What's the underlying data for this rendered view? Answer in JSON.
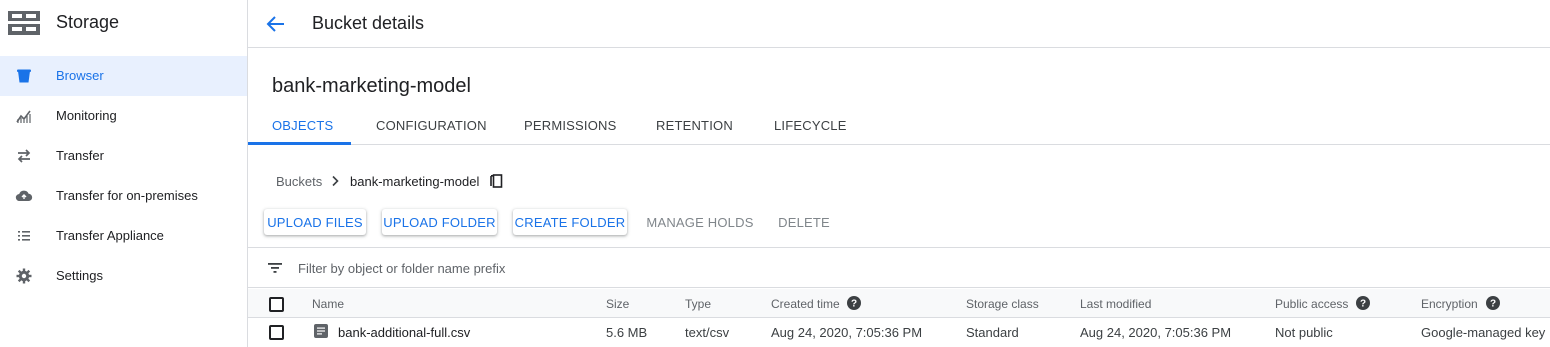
{
  "sidebar": {
    "title": "Storage",
    "items": [
      {
        "label": "Browser",
        "icon": "bucket-icon"
      },
      {
        "label": "Monitoring",
        "icon": "chart-icon"
      },
      {
        "label": "Transfer",
        "icon": "transfer-arrows-icon"
      },
      {
        "label": "Transfer for on-premises",
        "icon": "cloud-upload-icon"
      },
      {
        "label": "Transfer Appliance",
        "icon": "list-icon"
      },
      {
        "label": "Settings",
        "icon": "gear-icon"
      }
    ],
    "active_index": 0
  },
  "header": {
    "title": "Bucket details"
  },
  "bucket": {
    "name": "bank-marketing-model"
  },
  "tabs": [
    {
      "label": "OBJECTS"
    },
    {
      "label": "CONFIGURATION"
    },
    {
      "label": "PERMISSIONS"
    },
    {
      "label": "RETENTION"
    },
    {
      "label": "LIFECYCLE"
    }
  ],
  "breadcrumb": {
    "root": "Buckets",
    "current": "bank-marketing-model"
  },
  "actions": {
    "upload_files": "UPLOAD FILES",
    "upload_folder": "UPLOAD FOLDER",
    "create_folder": "CREATE FOLDER",
    "manage_holds": "MANAGE HOLDS",
    "delete": "DELETE"
  },
  "filter": {
    "placeholder": "Filter by object or folder name prefix"
  },
  "table": {
    "columns": {
      "name": "Name",
      "size": "Size",
      "type": "Type",
      "created": "Created time",
      "storage_class": "Storage class",
      "last_modified": "Last modified",
      "public_access": "Public access",
      "encryption": "Encryption"
    },
    "rows": [
      {
        "name": "bank-additional-full.csv",
        "size": "5.6 MB",
        "type": "text/csv",
        "created": "Aug 24, 2020, 7:05:36 PM",
        "storage_class": "Standard",
        "last_modified": "Aug 24, 2020, 7:05:36 PM",
        "public_access": "Not public",
        "encryption": "Google-managed key"
      }
    ]
  },
  "colors": {
    "accent": "#1a73e8",
    "active_bg": "#e8f0fe",
    "border": "#dadce0"
  }
}
